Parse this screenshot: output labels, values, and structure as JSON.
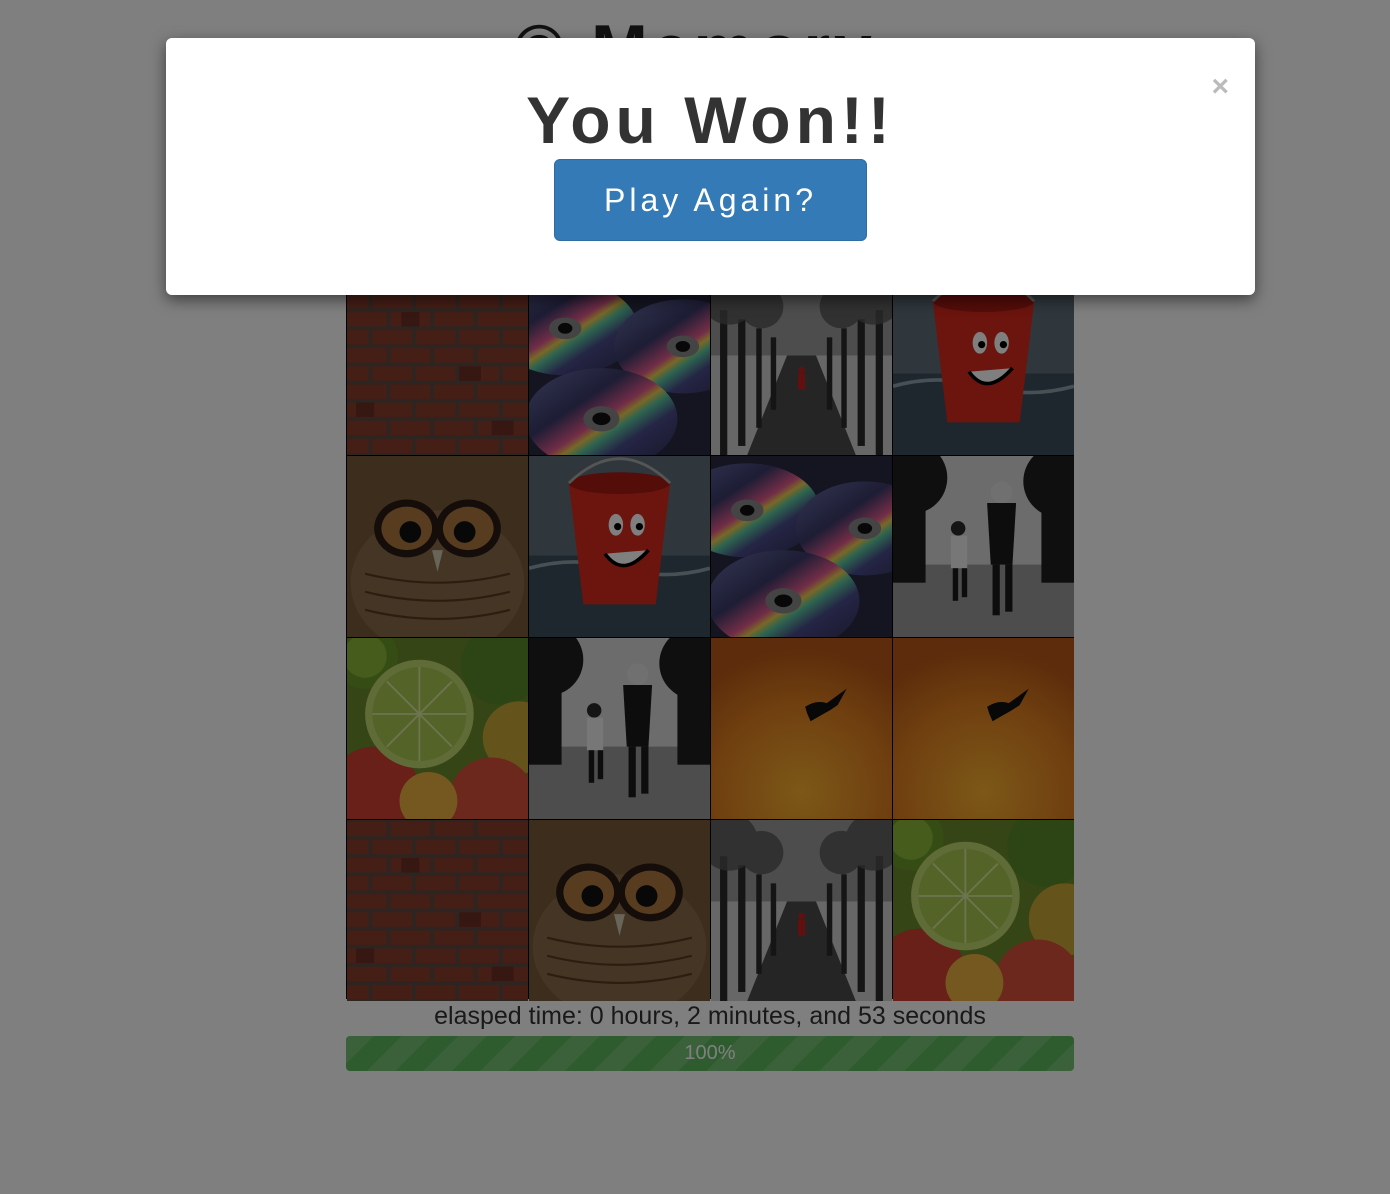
{
  "page": {
    "title": "© Memory"
  },
  "modal": {
    "title": "You Won!!",
    "button_label": "Play Again?",
    "close_icon": "×"
  },
  "status": {
    "elapsed": "elasped time: 0 hours, 2 minutes, and 53 seconds",
    "progress_label": "100%",
    "progress_value": 100
  },
  "board": {
    "cards": [
      "brick-wall",
      "compact-discs",
      "tree-alley",
      "red-bucket",
      "owl",
      "red-bucket",
      "compact-discs",
      "children-running",
      "limes-apples",
      "children-running",
      "bird-sunset",
      "bird-sunset",
      "brick-wall",
      "owl",
      "tree-alley",
      "limes-apples"
    ]
  },
  "colors": {
    "primary": "#337ab7",
    "success": "#5cb85c"
  }
}
